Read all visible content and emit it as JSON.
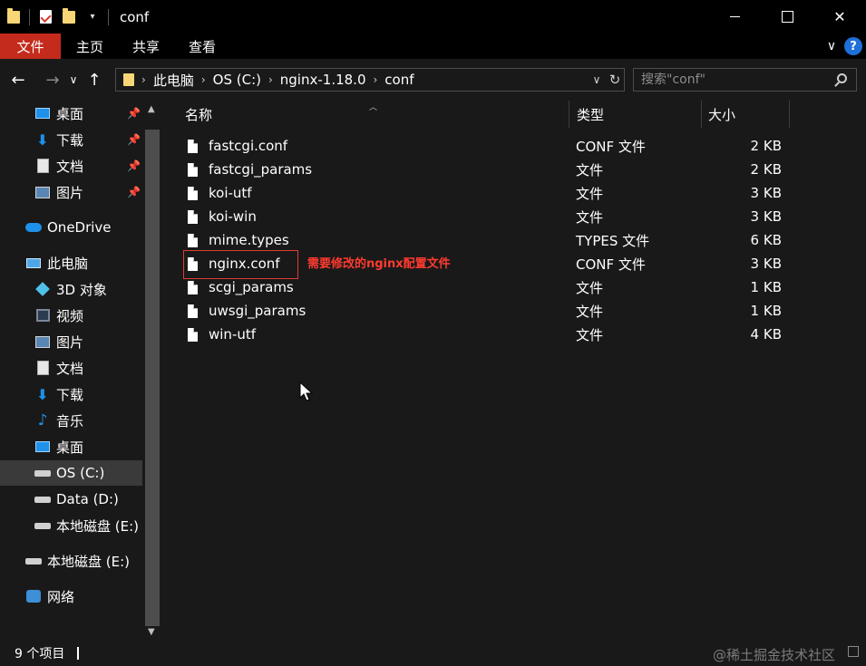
{
  "window": {
    "title": "conf",
    "minimize_icon": "minimize-icon",
    "maximize_icon": "maximize-icon",
    "close_label": "✕"
  },
  "ribbon": {
    "file_tab": "文件",
    "tabs": [
      "主页",
      "共享",
      "查看"
    ],
    "expand_chevron": "∨",
    "help_label": "?"
  },
  "navigation": {
    "back": "←",
    "forward": "→",
    "recent": "∨",
    "up": "↑"
  },
  "address": {
    "crumbs": [
      "此电脑",
      "OS (C:)",
      "nginx-1.18.0",
      "conf"
    ],
    "separator": "›",
    "dropdown": "∨",
    "refresh": "↻"
  },
  "search": {
    "placeholder": "搜索\"conf\""
  },
  "sidebar": {
    "quick_access": [
      {
        "label": "桌面",
        "icon": "desktop-icon",
        "pinned": true
      },
      {
        "label": "下载",
        "icon": "download-icon",
        "pinned": true
      },
      {
        "label": "文档",
        "icon": "document-icon",
        "pinned": true
      },
      {
        "label": "图片",
        "icon": "picture-icon",
        "pinned": true
      }
    ],
    "onedrive": "OneDrive",
    "this_pc": "此电脑",
    "pc_items": [
      {
        "label": "3D 对象",
        "icon": "3d-objects-icon"
      },
      {
        "label": "视频",
        "icon": "video-icon"
      },
      {
        "label": "图片",
        "icon": "picture-icon"
      },
      {
        "label": "文档",
        "icon": "document-icon"
      },
      {
        "label": "下载",
        "icon": "download-icon"
      },
      {
        "label": "音乐",
        "icon": "music-icon"
      },
      {
        "label": "桌面",
        "icon": "desktop-icon"
      },
      {
        "label": "OS (C:)",
        "icon": "drive-icon",
        "selected": true
      },
      {
        "label": "Data (D:)",
        "icon": "drive-icon"
      },
      {
        "label": "本地磁盘 (E:)",
        "icon": "drive-icon"
      }
    ],
    "local_disk_e": "本地磁盘 (E:)",
    "network": "网络",
    "pin_glyph": "📌"
  },
  "list": {
    "columns": {
      "name": "名称",
      "type": "类型",
      "size": "大小"
    },
    "files": [
      {
        "name": "fastcgi.conf",
        "type": "CONF 文件",
        "size": "2 KB"
      },
      {
        "name": "fastcgi_params",
        "type": "文件",
        "size": "2 KB"
      },
      {
        "name": "koi-utf",
        "type": "文件",
        "size": "3 KB"
      },
      {
        "name": "koi-win",
        "type": "文件",
        "size": "3 KB"
      },
      {
        "name": "mime.types",
        "type": "TYPES 文件",
        "size": "6 KB"
      },
      {
        "name": "nginx.conf",
        "type": "CONF 文件",
        "size": "3 KB"
      },
      {
        "name": "scgi_params",
        "type": "文件",
        "size": "1 KB"
      },
      {
        "name": "uwsgi_params",
        "type": "文件",
        "size": "1 KB"
      },
      {
        "name": "win-utf",
        "type": "文件",
        "size": "4 KB"
      }
    ],
    "annotation": "需要修改的nginx配置文件",
    "highlight_color": "#e03c31"
  },
  "status": {
    "item_count": "9 个项目",
    "watermark": "@稀土掘金技术社区"
  },
  "colors": {
    "file_tab": "#c42b1c",
    "background": "#191919",
    "titlebar": "#000000",
    "help": "#1e6fd9"
  }
}
